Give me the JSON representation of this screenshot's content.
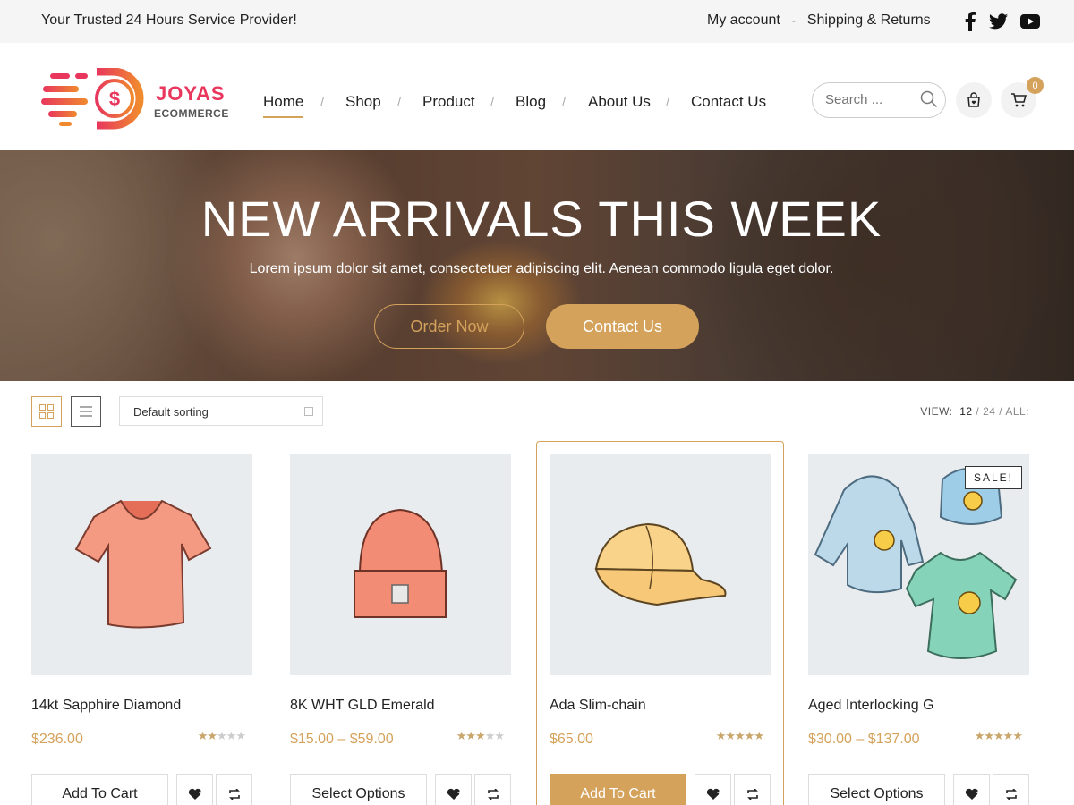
{
  "topbar": {
    "tagline": "Your Trusted 24 Hours Service Provider!",
    "links": [
      "My account",
      "Shipping & Returns"
    ],
    "separator": "-",
    "social": [
      "facebook-icon",
      "twitter-icon",
      "youtube-icon"
    ]
  },
  "logo": {
    "line1": "JOYAS",
    "line2": "ECOMMERCE"
  },
  "nav": {
    "items": [
      "Home",
      "Shop",
      "Product",
      "Blog",
      "About Us",
      "Contact Us"
    ],
    "active": "Home",
    "separator": "/"
  },
  "search": {
    "placeholder": "Search ..."
  },
  "cart": {
    "count": "0"
  },
  "hero": {
    "title": "NEW ARRIVALS THIS WEEK",
    "subtitle": "Lorem ipsum dolor sit amet, consectetuer adipiscing elit. Aenean commodo ligula eget dolor.",
    "buttons": [
      "Order Now",
      "Contact Us"
    ]
  },
  "toolbar": {
    "sorting": "Default sorting",
    "view_label": "VIEW:",
    "view_options": [
      "12",
      "24",
      "ALL:"
    ],
    "view_selected": "12",
    "separator": "/"
  },
  "products": [
    {
      "name": "14kt Sapphire Diamond",
      "price": "$236.00",
      "rating": 2.5,
      "button": "Add To Cart",
      "sale": ""
    },
    {
      "name": "8K WHT GLD Emerald",
      "price": "$15.00 – $59.00",
      "rating": 3.5,
      "button": "Select Options",
      "sale": ""
    },
    {
      "name": "Ada Slim-chain",
      "price": "$65.00",
      "rating": 5,
      "button": "Add To Cart",
      "sale": ""
    },
    {
      "name": "Aged Interlocking G",
      "price": "$30.00 – $137.00",
      "rating": 5,
      "button": "Select Options",
      "sale": "SALE!"
    }
  ],
  "colors": {
    "accent": "#d4a25b",
    "brand": "#e8365d",
    "topbar_bg": "#f5f5f5",
    "product_bg": "#e9ecef"
  }
}
